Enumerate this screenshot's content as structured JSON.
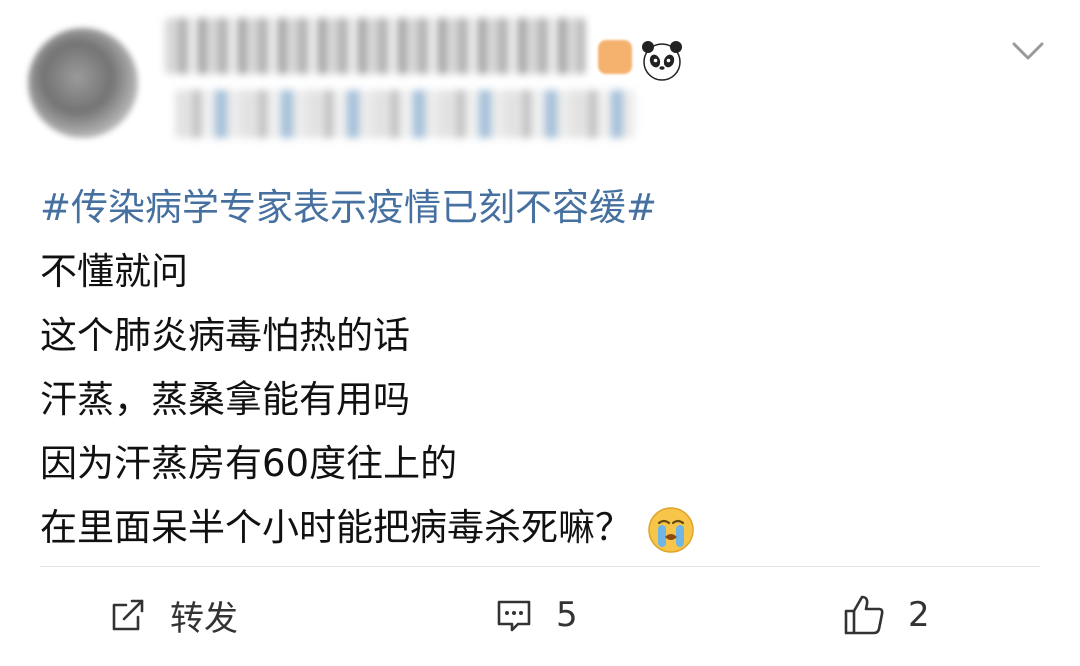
{
  "post": {
    "hashtag": "#传染病学专家表示疫情已刻不容缓#",
    "lines": [
      "不懂就问",
      "这个肺炎病毒怕热的话",
      "汗蒸，蒸桑拿能有用吗",
      "因为汗蒸房有60度往上的",
      "在里面呆半个小时能把病毒杀死嘛？"
    ],
    "emoji": "crying-face"
  },
  "header": {
    "icons": [
      "user-avatar-blurred",
      "panda-emoji",
      "chevron-down-icon"
    ]
  },
  "actions": {
    "repost_label": "转发",
    "comment_count": "5",
    "like_count": "2"
  },
  "colors": {
    "hashtag": "#46709f",
    "text": "#111111",
    "action_text": "#333333",
    "divider": "#e6e6e6"
  }
}
